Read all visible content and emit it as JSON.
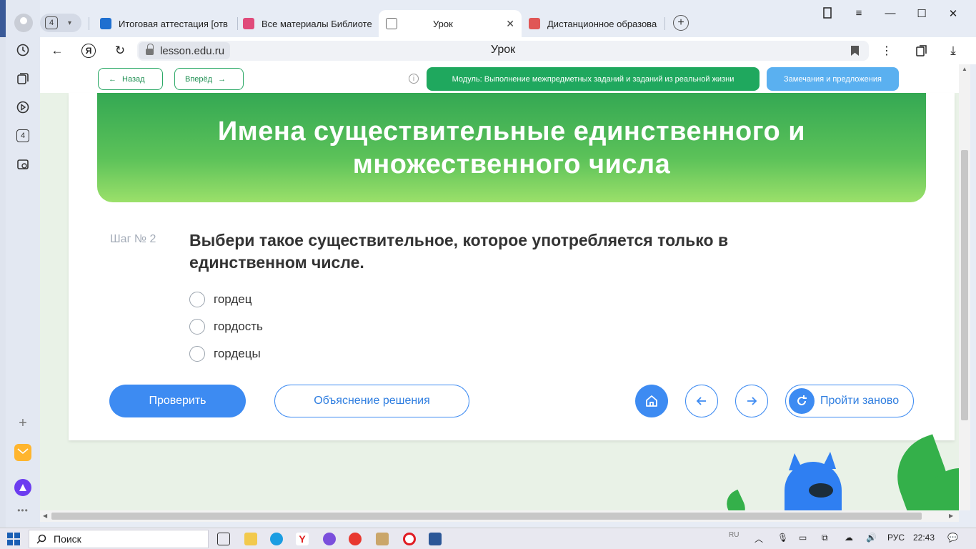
{
  "browser": {
    "tab_count": "4",
    "tabs": [
      {
        "title": "Итоговая аттестация [отв",
        "color": "#1e6fd0",
        "active": false
      },
      {
        "title": "Все материалы Библиоте",
        "color": "#e04a7a",
        "active": false
      },
      {
        "title": "Урок",
        "color": "#666666",
        "active": true
      },
      {
        "title": "Дистанционное образова",
        "color": "#e05656",
        "active": false
      }
    ],
    "url": "lesson.edu.ru",
    "page_title": "Урок",
    "sidebar_badge": "4"
  },
  "lesson_header": {
    "back_label": "Назад",
    "forward_label": "Вперёд",
    "module_label": "Модуль: Выполнение межпредметных заданий и заданий из реальной жизни",
    "remarks_label": "Замечания и предложения"
  },
  "lesson": {
    "title": "Имена существительные единственного и множественного числа",
    "step_label": "Шаг № 2",
    "question": "Выбери такое существительное, которое употребляется только в единственном числе.",
    "options": [
      "гордец",
      "гордость",
      "гордецы"
    ],
    "check_label": "Проверить",
    "explain_label": "Объяснение решения",
    "restart_label": "Пройти заново"
  },
  "taskbar": {
    "search_placeholder": "Поиск",
    "lang_small": "RU",
    "lang": "РУС",
    "time": "22:43"
  }
}
